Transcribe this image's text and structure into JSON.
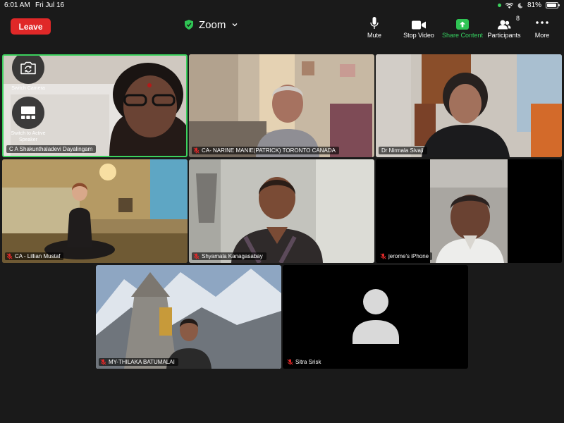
{
  "status_bar": {
    "time": "6:01 AM",
    "date": "Fri Jul 16",
    "battery": "81%",
    "battery_level": 0.81
  },
  "toolbar": {
    "leave_label": "Leave",
    "meeting_title": "Zoom",
    "mute_label": "Mute",
    "stop_video_label": "Stop Video",
    "share_content_label": "Share Content",
    "participants_label": "Participants",
    "participants_count": "8",
    "more_label": "More"
  },
  "overlay": {
    "switch_camera_label": "Switch Camera",
    "switch_speaker_label": "Switch to Active Speaker"
  },
  "participants": [
    {
      "name": "C A Shakunthaladevi Dayalingam"
    },
    {
      "name": "CA- NARINE MANIE(PATRICK) TORONTO CANADA"
    },
    {
      "name": "Dr Nirmala Sivaji"
    },
    {
      "name": "CA - Lillian Mustaf"
    },
    {
      "name": "Shyamala Kanagasabay"
    },
    {
      "name": "jerome's iPhone"
    },
    {
      "name": "MY-THILAKA BATUMALAI"
    },
    {
      "name": "Sitra Srisk"
    }
  ],
  "colors": {
    "leave": "#e02828",
    "share": "#36d160",
    "active_speaker_border": "#3bd15d",
    "muted_mic": "#e02828"
  }
}
